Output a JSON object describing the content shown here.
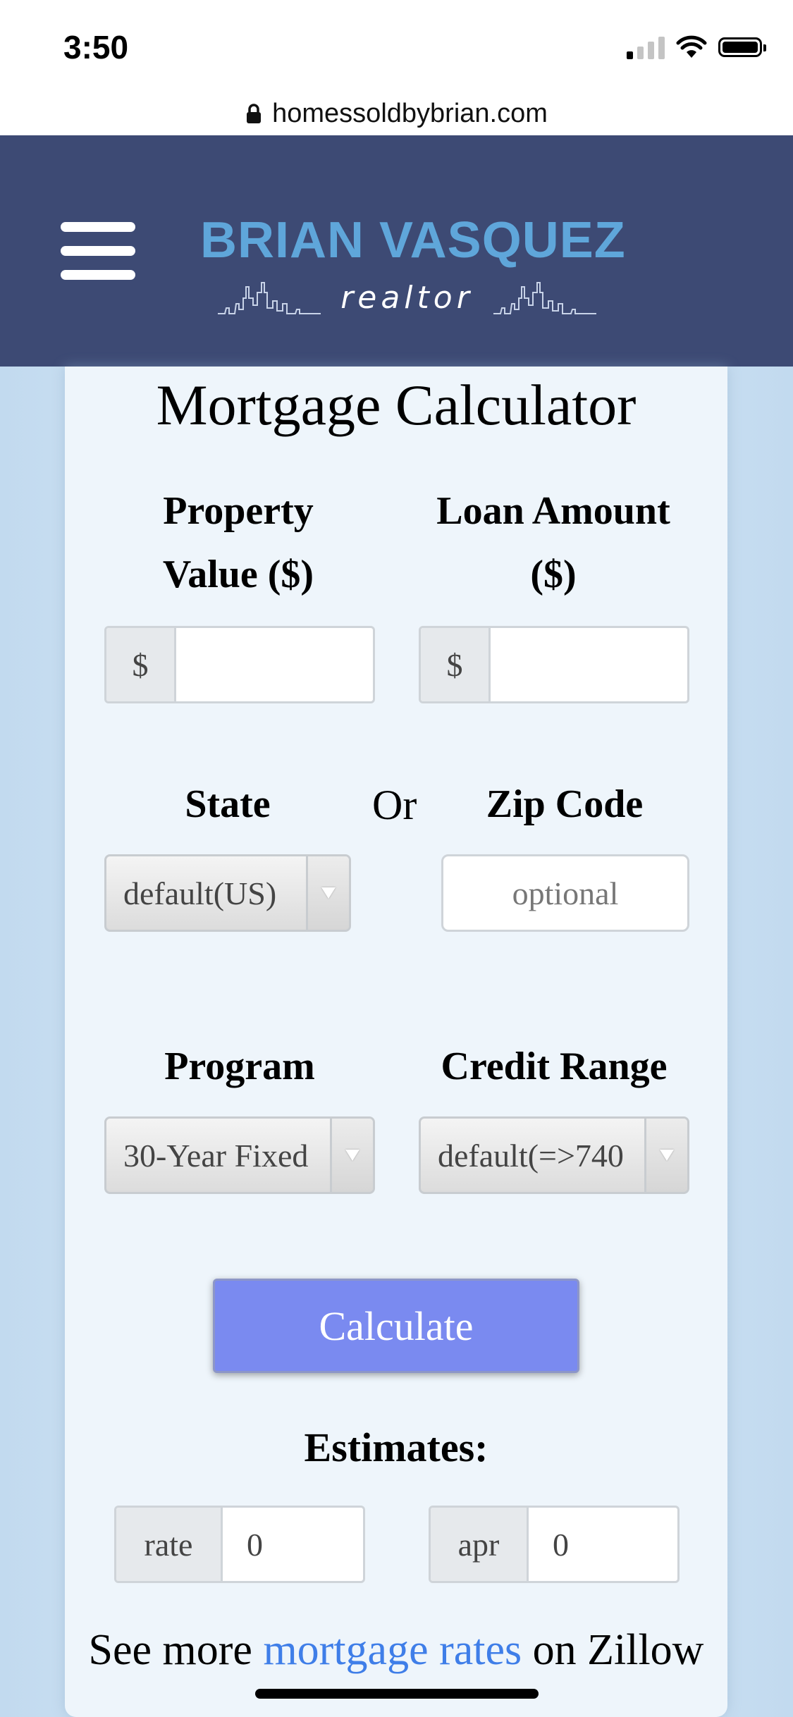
{
  "status_bar": {
    "time": "3:50"
  },
  "browser": {
    "url": "homessoldbybrian.com"
  },
  "header": {
    "brand_name": "BRIAN VASQUEZ",
    "brand_sub": "realtor"
  },
  "calculator": {
    "title": "Mortgage Calculator",
    "property_value_label_line1": "Property",
    "property_value_label_line2": "Value ($)",
    "property_value_prefix": "$",
    "property_value": "",
    "loan_amount_label_line1": "Loan Amount",
    "loan_amount_label_line2": "($)",
    "loan_amount_prefix": "$",
    "loan_amount": "",
    "state_label": "State",
    "or_label": "Or",
    "zip_label": "Zip Code",
    "state_selected": "default(US)",
    "zip_placeholder": "optional",
    "program_label": "Program",
    "credit_label": "Credit Range",
    "program_selected": "30-Year Fixed",
    "credit_selected": "default(=>740",
    "calculate_label": "Calculate",
    "estimates_label": "Estimates:",
    "rate_label": "rate",
    "rate_value": "0",
    "apr_label": "apr",
    "apr_value": "0",
    "zillow_prefix": "See more ",
    "zillow_link": "mortgage rates",
    "zillow_suffix": " on Zillow"
  },
  "colors": {
    "header_bg": "#3d4a74",
    "brand_accent": "#5fa6da",
    "button_bg": "#7a8af0",
    "link": "#3f7ee8"
  }
}
